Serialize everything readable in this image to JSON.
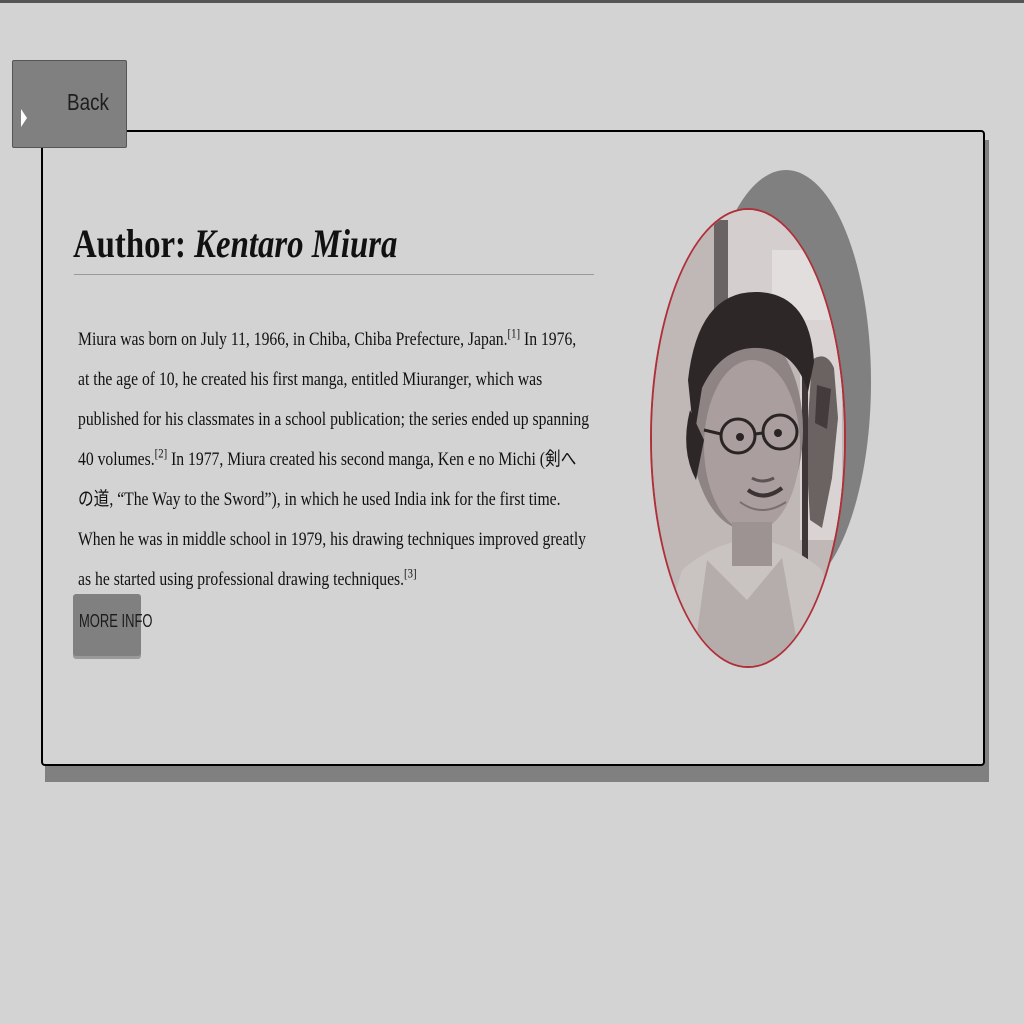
{
  "navigation": {
    "back_label": "Back"
  },
  "author": {
    "heading_prefix": "Author:",
    "name": "Kentaro Miura"
  },
  "bio": {
    "text_1": "Miura was born on July 11, 1966, in Chiba, Chiba Prefecture, Japan.",
    "ref_1": "[1]",
    "text_2": " In 1976, at the age of 10, he created his first manga, entitled Miuranger, which was published for his classmates in a school publication; the series ended up spanning 40 volumes.",
    "ref_2": "[2]",
    "text_3": " In 1977, Miura created his second manga, Ken e no Michi (剣への道, “The Way to the Sword”), in which he used India ink for the first time. When he was in middle school in 1979, his drawing techniques improved greatly as he started using professional drawing techniques.",
    "ref_3": "[3]"
  },
  "actions": {
    "more_info_label": "MORE INFO"
  },
  "colors": {
    "page_background": "#d3d3d3",
    "button_gray": "#808080",
    "photo_border": "#b0303a"
  },
  "icons": {
    "back": "caret-right-icon"
  }
}
